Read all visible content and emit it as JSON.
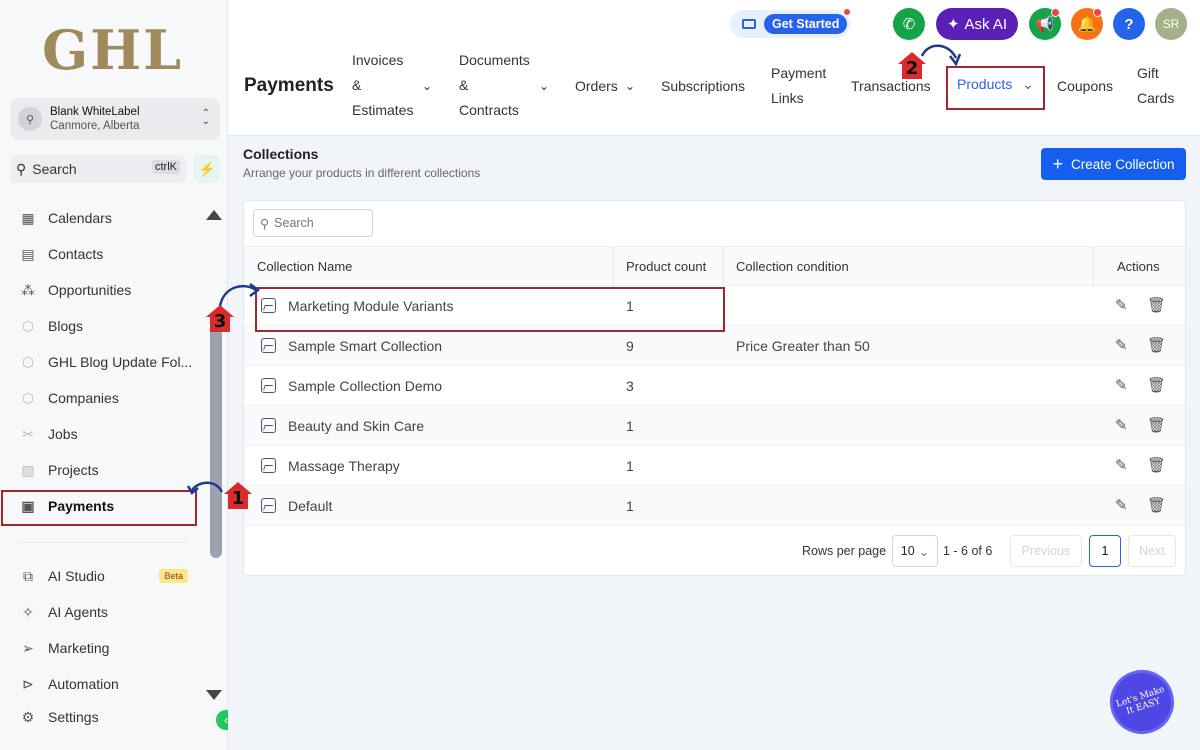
{
  "logo": "GHL",
  "account": {
    "name": "Blank WhiteLabel",
    "location": "Canmore, Alberta"
  },
  "sidebar_search": {
    "label": "Search",
    "shortcut": "ctrlK"
  },
  "sidebar": {
    "items": [
      {
        "label": "Calendars",
        "icon": "calendar-icon"
      },
      {
        "label": "Contacts",
        "icon": "contacts-icon"
      },
      {
        "label": "Opportunities",
        "icon": "opportunities-icon"
      },
      {
        "label": "Blogs",
        "icon": "cube-icon"
      },
      {
        "label": "GHL Blog Update Fol...",
        "icon": "cube-icon"
      },
      {
        "label": "Companies",
        "icon": "cube-icon"
      },
      {
        "label": "Jobs",
        "icon": "jobs-icon"
      },
      {
        "label": "Projects",
        "icon": "projects-icon"
      },
      {
        "label": "Payments",
        "icon": "payments-icon"
      }
    ],
    "bottom_items": [
      {
        "label": "AI Studio",
        "icon": "ai-studio-icon",
        "badge": "Beta"
      },
      {
        "label": "AI Agents",
        "icon": "sparkle-icon"
      },
      {
        "label": "Marketing",
        "icon": "send-icon"
      },
      {
        "label": "Automation",
        "icon": "automation-icon"
      },
      {
        "label": "Settings",
        "icon": "gear-icon"
      }
    ]
  },
  "topbar": {
    "get_started": "Get Started",
    "ask_ai": "Ask AI",
    "avatar_initials": "SR",
    "help": "?"
  },
  "page_title": "Payments",
  "tabs": [
    {
      "line1": "Invoices",
      "line2": "&",
      "line3": "Estimates"
    },
    {
      "line1": "Documents",
      "line2": "&",
      "line3": "Contracts"
    },
    {
      "label": "Orders"
    },
    {
      "label": "Subscriptions"
    },
    {
      "line1": "Payment",
      "line2": "Links"
    },
    {
      "label": "Transactions"
    },
    {
      "label": "Products"
    },
    {
      "label": "Coupons"
    },
    {
      "line1": "Gift",
      "line2": "Cards"
    }
  ],
  "collections": {
    "title": "Collections",
    "subtitle": "Arrange your products in different collections",
    "create_button": "Create Collection",
    "search_placeholder": "Search",
    "columns": [
      "Collection Name",
      "Product count",
      "Collection condition",
      "Actions"
    ],
    "rows": [
      {
        "name": "Marketing Module Variants",
        "count": "1",
        "condition": ""
      },
      {
        "name": "Sample Smart Collection",
        "count": "9",
        "condition": "Price Greater than 50"
      },
      {
        "name": "Sample Collection Demo",
        "count": "3",
        "condition": ""
      },
      {
        "name": "Beauty and Skin Care",
        "count": "1",
        "condition": ""
      },
      {
        "name": "Massage Therapy",
        "count": "1",
        "condition": ""
      },
      {
        "name": "Default",
        "count": "1",
        "condition": ""
      }
    ],
    "pagination": {
      "rows_per_page_label": "Rows per page",
      "rows_per_page": "10",
      "range": "1 - 6 of 6",
      "previous": "Previous",
      "current": "1",
      "next": "Next"
    }
  },
  "markers": [
    "1",
    "2",
    "3"
  ],
  "watermark": "Let's Make It EASY",
  "colors": {
    "accent": "#155eef",
    "highlight": "#a3262a",
    "marker": "#d92b2b"
  }
}
